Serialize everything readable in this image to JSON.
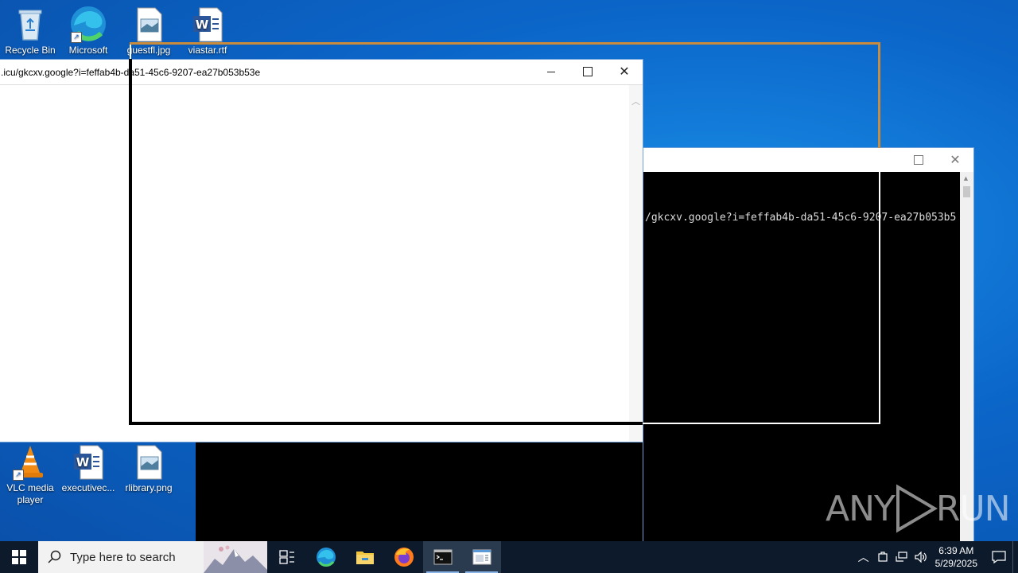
{
  "desktop": {
    "icons_top": [
      {
        "label": "Recycle Bin",
        "icon": "recycle-bin-icon"
      },
      {
        "label": "Microsoft",
        "icon": "edge-icon"
      },
      {
        "label": "guestfl.jpg",
        "icon": "image-file-icon"
      },
      {
        "label": "viastar.rtf",
        "icon": "word-doc-icon"
      }
    ],
    "icons_bottom": [
      {
        "label": "VLC media player",
        "icon": "vlc-icon"
      },
      {
        "label": "executivec...",
        "icon": "word-doc-icon"
      },
      {
        "label": "rlibrary.png",
        "icon": "image-file-icon"
      }
    ]
  },
  "popup_window": {
    "url": ".icu/gkcxv.google?i=feffab4b-da51-45c6-9207-ea27b053b53e"
  },
  "console_window": {
    "line": "/gkcxv.google?i=feffab4b-da51-45c6-9207-ea27b053b5"
  },
  "taskbar": {
    "search_placeholder": "Type here to search",
    "apps": [
      "task-view-icon",
      "edge-icon",
      "file-explorer-icon",
      "firefox-icon",
      "cmd-icon",
      "window-app-icon"
    ],
    "time": "6:39 AM",
    "date": "5/29/2025"
  },
  "watermark": {
    "text_left": "ANY",
    "text_right": "RUN"
  },
  "colors": {
    "desktop_blue": "#0b66c9",
    "taskbar": "#0d1a2b",
    "selection_orange": "#c88c3c"
  }
}
